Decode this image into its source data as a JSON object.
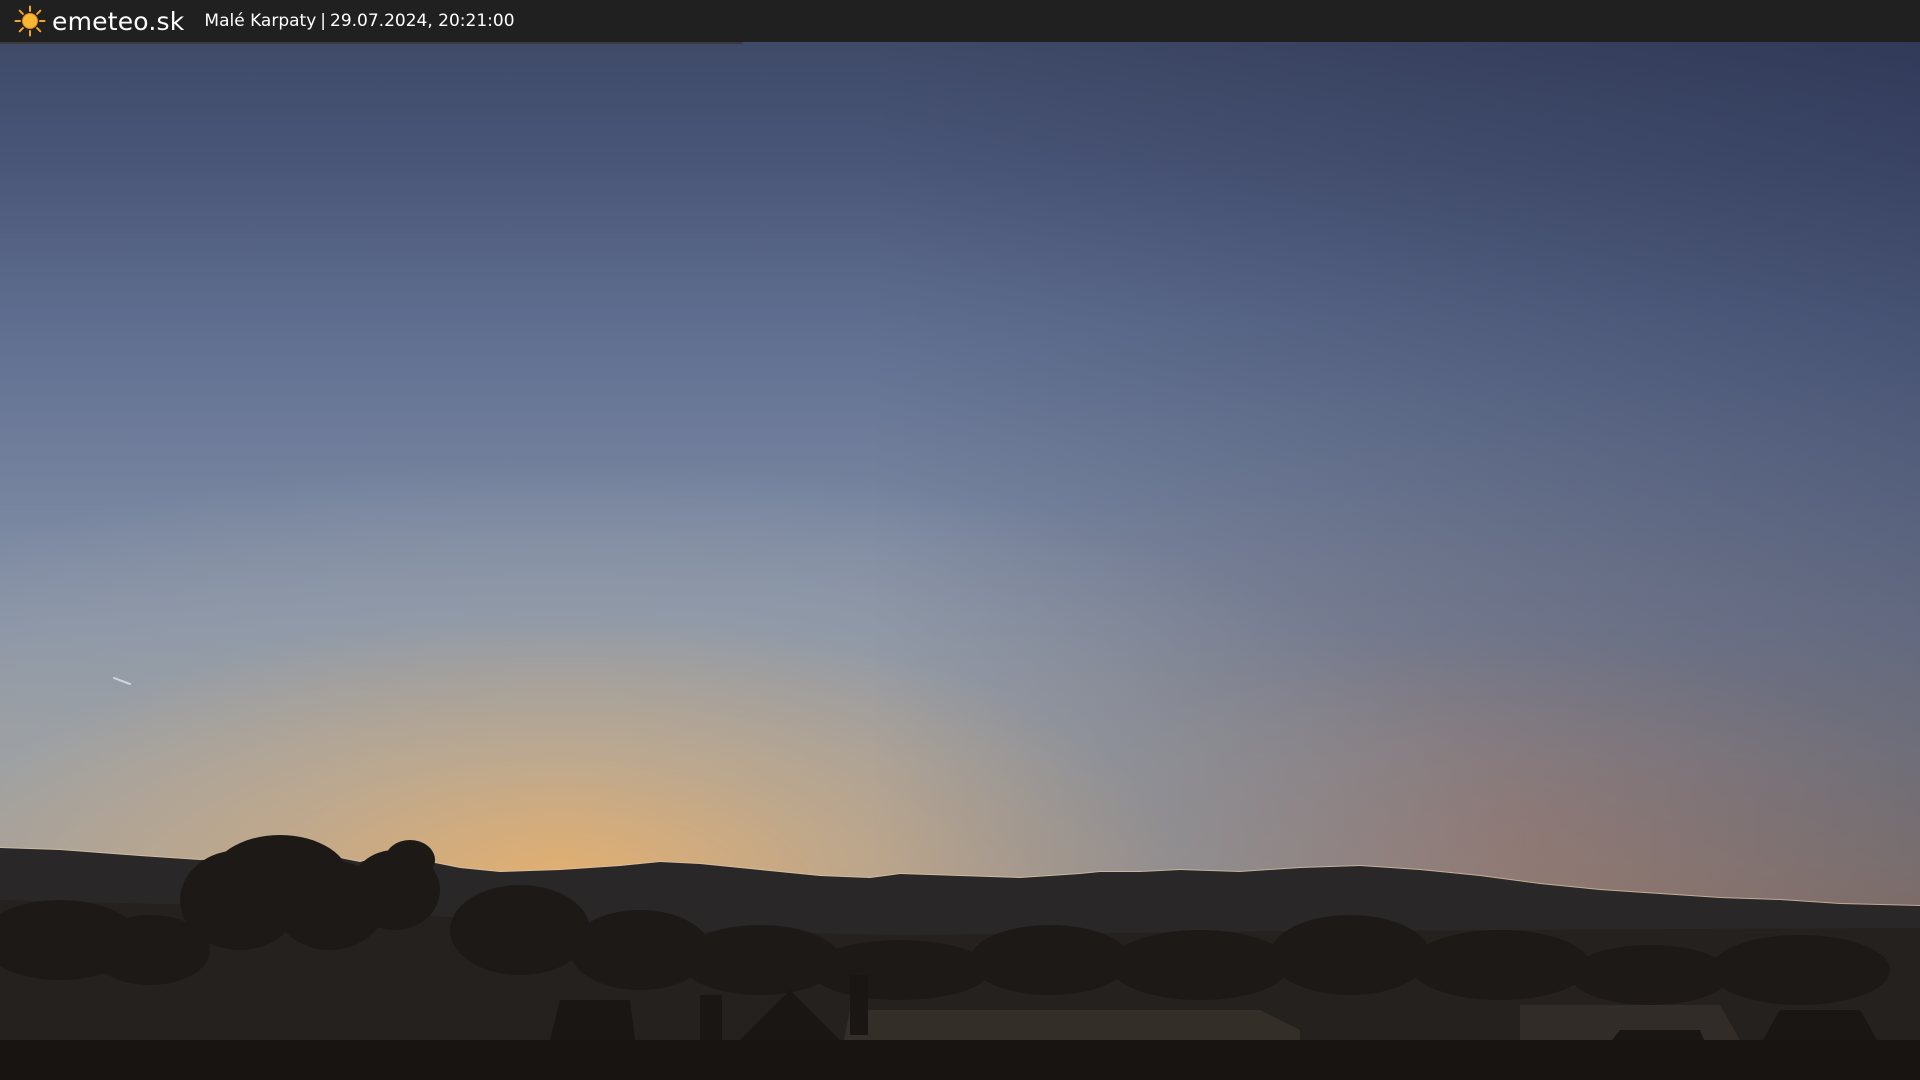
{
  "header": {
    "brand": "emeteo.sk",
    "location": "Malé Karpaty",
    "separator": "|",
    "datetime": "29.07.2024, 20:21:00",
    "logo_icon": "sun-icon"
  },
  "colors": {
    "bar_background": "#202020",
    "sun_icon": "#f5a623",
    "sky_top": "#3b4663",
    "horizon_glow": "#d9a06a",
    "silhouette": "#1c1815"
  }
}
